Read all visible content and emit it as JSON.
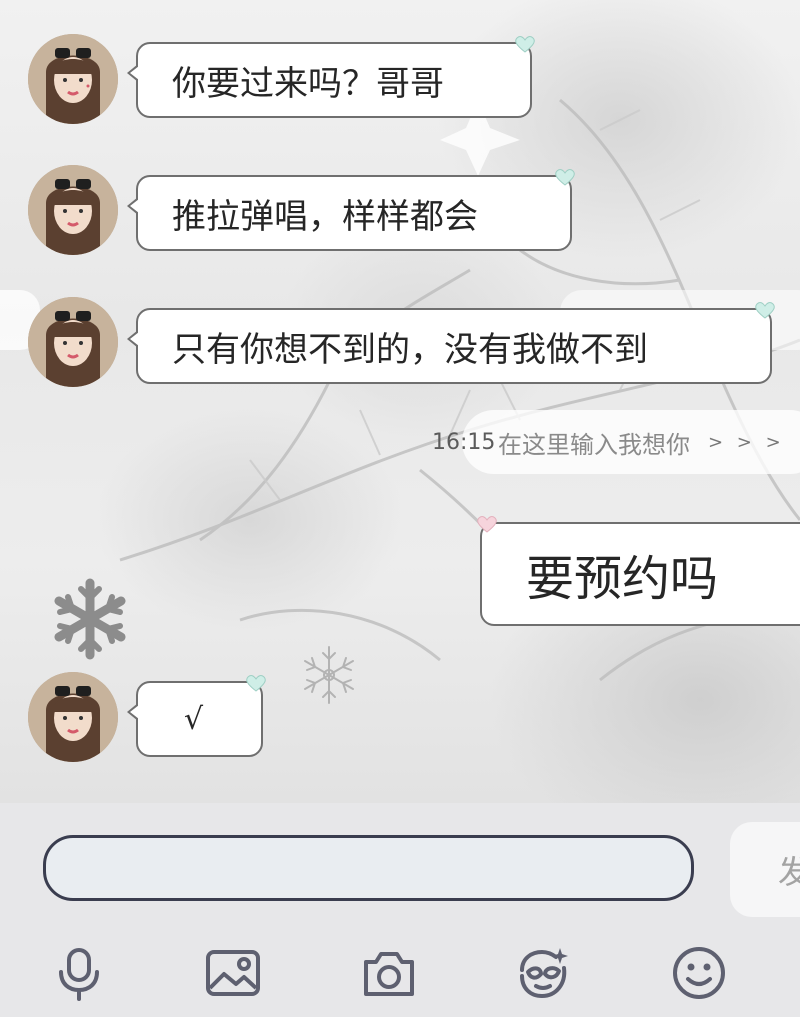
{
  "messages": [
    {
      "side": "incoming",
      "text": "你要过来吗？哥哥"
    },
    {
      "side": "incoming",
      "text": "推拉弹唱，样样都会"
    },
    {
      "side": "incoming",
      "text": "只有你想不到的，没有我做不到"
    },
    {
      "side": "outgoing",
      "text": "要预约吗"
    },
    {
      "side": "incoming",
      "text": "√"
    }
  ],
  "timestamp": "16:15",
  "background_hint": {
    "text": "在这里输入我想你",
    "arrows": "> > >"
  },
  "composer": {
    "input_value": "",
    "send_label": "发"
  },
  "toolbar_icons": [
    "microphone-icon",
    "image-icon",
    "camera-icon",
    "sticker-icon",
    "emoji-icon"
  ],
  "colors": {
    "bubble_border": "#6f6f6f",
    "bubble_fill": "#ffffff",
    "heart_mint": "#cfeee7",
    "heart_pink": "#f6d4dc",
    "input_border": "#3a3d4f",
    "panel_bg": "#e7e7e9",
    "icon": "#5e6070"
  }
}
